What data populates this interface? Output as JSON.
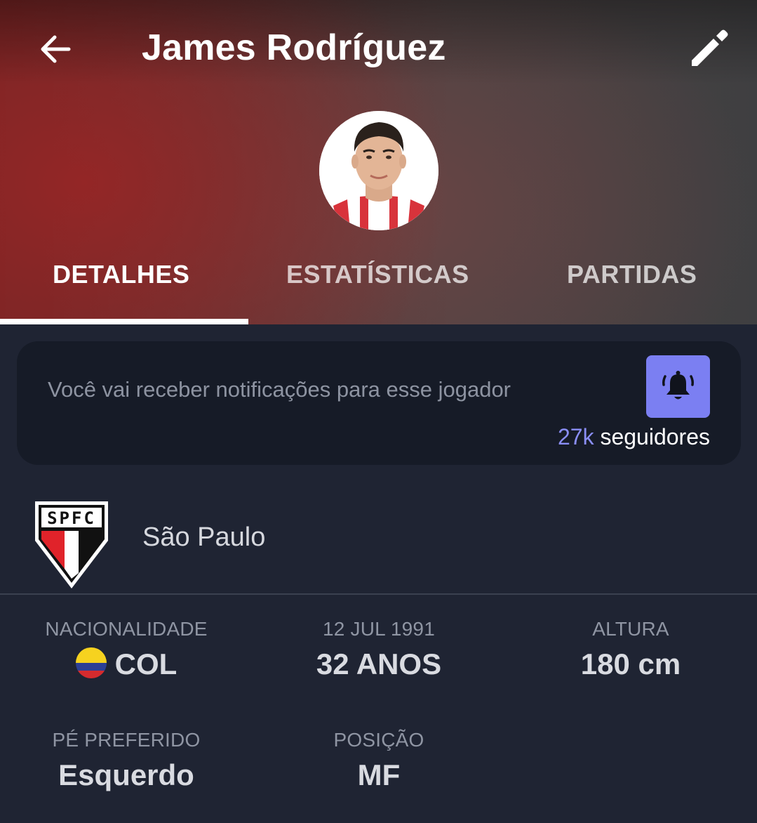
{
  "header": {
    "title": "James Rodríguez",
    "back_icon": "arrow-left-icon",
    "edit_icon": "pencil-icon"
  },
  "tabs": [
    {
      "label": "DETALHES",
      "active": true
    },
    {
      "label": "ESTATÍSTICAS",
      "active": false
    },
    {
      "label": "PARTIDAS",
      "active": false
    }
  ],
  "notification": {
    "text": "Você vai receber notificações para esse jogador",
    "bell_icon": "bell-ringing-icon",
    "followers_count": "27k",
    "followers_label": "seguidores"
  },
  "club": {
    "name": "São Paulo",
    "crest_text": "SPFC"
  },
  "details": {
    "nationality_label": "NACIONALIDADE",
    "nationality_value": "COL",
    "birth_label": "12 JUL 1991",
    "age_value": "32 ANOS",
    "height_label": "ALTURA",
    "height_value": "180 cm",
    "foot_label": "PÉ PREFERIDO",
    "foot_value": "Esquerdo",
    "position_label": "POSIÇÃO",
    "position_value": "MF"
  },
  "colors": {
    "accent": "#7b7ff2",
    "background": "#1f2433",
    "card": "#161b27"
  }
}
